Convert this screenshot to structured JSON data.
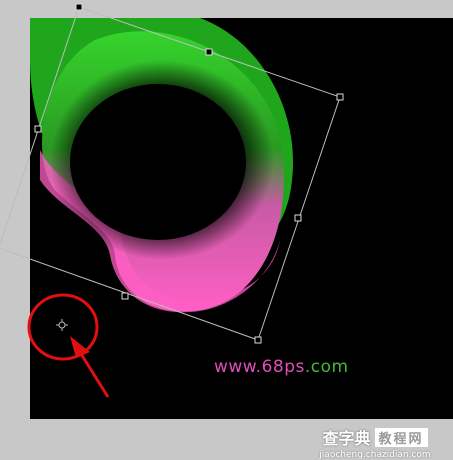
{
  "canvas": {
    "background_color": "#000000",
    "workspace_color": "#c8c8c8",
    "shape_gradient": [
      "#2fcf2a",
      "#ff5bbf"
    ]
  },
  "overlay": {
    "transform_box_color": "#bfbfbf",
    "highlight_circle_color": "#e01010",
    "arrow_color": "#e01010",
    "pivot_icon": "crosshair-pivot-icon"
  },
  "watermark": {
    "part1": "www.",
    "part2": "68ps",
    "part3": ".com",
    "color_pink": "#e04fb7",
    "color_green": "#45b83a"
  },
  "footer_logo": {
    "title": "查字典",
    "box_text": "教程网",
    "url": "jiaocheng.chazidian.com"
  }
}
